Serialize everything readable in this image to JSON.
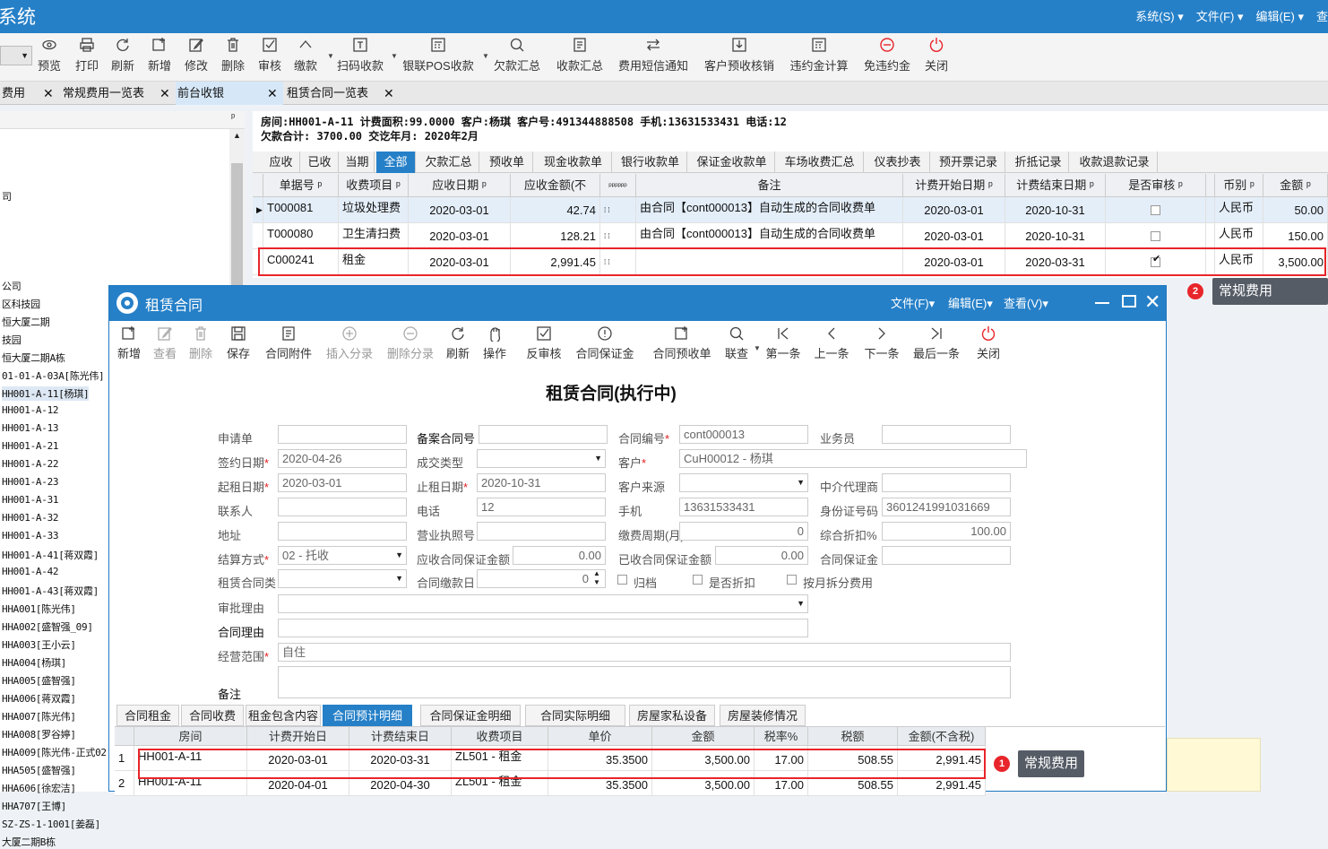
{
  "app": {
    "title": "系统",
    "menu": [
      "系统(S)",
      "文件(F)",
      "编辑(E)",
      "查"
    ]
  },
  "toolbar": [
    {
      "label": "预览",
      "icon": "eye-icon"
    },
    {
      "label": "打印",
      "icon": "printer-icon"
    },
    {
      "label": "刷新",
      "icon": "refresh-icon"
    },
    {
      "label": "新增",
      "icon": "add-icon"
    },
    {
      "label": "修改",
      "icon": "edit-icon"
    },
    {
      "label": "删除",
      "icon": "trash-icon"
    },
    {
      "label": "审核",
      "icon": "check-icon"
    },
    {
      "label": "缴款",
      "icon": "chevron-up-icon"
    },
    {
      "label": "扫码收款",
      "icon": "scan-icon"
    },
    {
      "label": "银联POS收款",
      "icon": "calculator-icon"
    },
    {
      "label": "欠款汇总",
      "icon": "search-icon"
    },
    {
      "label": "收款汇总",
      "icon": "document-icon"
    },
    {
      "label": "费用短信通知",
      "icon": "transfer-icon"
    },
    {
      "label": "客户预收核销",
      "icon": "download-icon"
    },
    {
      "label": "违约金计算",
      "icon": "calculator-icon"
    },
    {
      "label": "免违约金",
      "icon": "minus-circle-icon"
    },
    {
      "label": "关闭",
      "icon": "power-icon"
    }
  ],
  "tabs": [
    {
      "label": "费用"
    },
    {
      "label": "常规费用一览表"
    },
    {
      "label": "前台收银",
      "active": true
    },
    {
      "label": "租赁合同一览表"
    }
  ],
  "tree": {
    "items": [
      "司",
      "公司",
      "区科技园",
      "恒大厦二期",
      "技园",
      "恒大厦二期A栋",
      "01-01-A-03A[陈光伟]",
      "HH001-A-11[杨琪]",
      "HH001-A-12",
      "HH001-A-13",
      "HH001-A-21",
      "HH001-A-22",
      "HH001-A-23",
      "HH001-A-31",
      "HH001-A-32",
      "HH001-A-33",
      "HH001-A-41[蒋双霞]",
      "HH001-A-42",
      "HH001-A-43[蒋双霞]",
      "HHA001[陈光伟]",
      "HHA002[盛智强_09]",
      "HHA003[王小云]",
      "HHA004[杨琪]",
      "HHA005[盛智强]",
      "HHA006[蒋双霞]",
      "HHA007[陈光伟]",
      "HHA008[罗谷婷]",
      "HHA009[陈光伟-正式02",
      "HHA505[盛智强]",
      "HHA606[徐宏洁]",
      "HHA707[王博]",
      "SZ-ZS-1-1001[姜磊]",
      "大厦二期B栋"
    ],
    "selected_index": 7
  },
  "info": {
    "line1": "房间:HH001-A-11  计费面积:99.0000 客户:杨琪 客户号:491344888508 手机:13631533431 电话:12",
    "line2": "欠款合计: 3700.00  交讫年月: 2020年2月"
  },
  "subtabs": [
    "应收",
    "已收",
    "当期",
    "全部",
    "欠款汇总",
    "预收单",
    "现金收款单",
    "银行收款单",
    "保证金收款单",
    "车场收费汇总",
    "仪表抄表",
    "预开票记录",
    "折抵记录",
    "收款退款记录"
  ],
  "subtab_active": "全部",
  "grid": {
    "columns": [
      "单据号",
      "收费项目",
      "应收日期",
      "应收金额(不",
      "备注",
      "计费开始日期",
      "计费结束日期",
      "是否审核",
      "币别",
      "金额"
    ],
    "rows": [
      {
        "no": "T000081",
        "item": "垃圾处理费",
        "date": "2020-03-01",
        "amount": "42.74",
        "note": "由合同【cont000013】自动生成的合同收费单",
        "start": "2020-03-01",
        "end": "2020-10-31",
        "audited": false,
        "currency": "人民币",
        "total": "50.00"
      },
      {
        "no": "T000080",
        "item": "卫生清扫费",
        "date": "2020-03-01",
        "amount": "128.21",
        "note": "由合同【cont000013】自动生成的合同收费单",
        "start": "2020-03-01",
        "end": "2020-10-31",
        "audited": false,
        "currency": "人民币",
        "total": "150.00"
      },
      {
        "no": "C000241",
        "item": "租金",
        "date": "2020-03-01",
        "amount": "2,991.45",
        "note": "",
        "start": "2020-03-01",
        "end": "2020-03-31",
        "audited": true,
        "currency": "人民币",
        "total": "3,500.00"
      }
    ]
  },
  "callouts": [
    {
      "num": "2",
      "text": "常规费用"
    },
    {
      "num": "1",
      "text": "常规费用"
    }
  ],
  "dialog": {
    "title": "租赁合同",
    "menu": [
      "文件(F)",
      "编辑(E)",
      "查看(V)"
    ],
    "toolbar": [
      {
        "label": "新增",
        "icon": "add-icon",
        "enabled": true
      },
      {
        "label": "查看",
        "icon": "edit-icon",
        "enabled": false
      },
      {
        "label": "删除",
        "icon": "trash-icon",
        "enabled": false
      },
      {
        "label": "保存",
        "icon": "save-icon",
        "enabled": true
      },
      {
        "label": "合同附件",
        "icon": "document-icon",
        "enabled": true
      },
      {
        "label": "插入分录",
        "icon": "plus-circle-icon",
        "enabled": false
      },
      {
        "label": "删除分录",
        "icon": "minus-circle-icon",
        "enabled": false
      },
      {
        "label": "刷新",
        "icon": "refresh-icon",
        "enabled": true
      },
      {
        "label": "操作",
        "icon": "hand-icon",
        "enabled": true
      },
      {
        "label": "反审核",
        "icon": "check-icon",
        "enabled": true
      },
      {
        "label": "合同保证金",
        "icon": "info-circle-icon",
        "enabled": true
      },
      {
        "label": "合同预收单",
        "icon": "add-icon",
        "enabled": true
      },
      {
        "label": "联查",
        "icon": "search-icon",
        "enabled": true
      },
      {
        "label": "第一条",
        "icon": "first-icon",
        "enabled": true
      },
      {
        "label": "上一条",
        "icon": "prev-icon",
        "enabled": true
      },
      {
        "label": "下一条",
        "icon": "next-icon",
        "enabled": true
      },
      {
        "label": "最后一条",
        "icon": "last-icon",
        "enabled": true
      },
      {
        "label": "关闭",
        "icon": "power-icon",
        "enabled": true
      }
    ],
    "form_title": "租赁合同(执行中)",
    "labels": {
      "apply": "申请单",
      "record_no": "备案合同号",
      "contract_no": "合同编号",
      "salesman": "业务员",
      "sign_date": "签约日期",
      "deal_type": "成交类型",
      "customer": "客户",
      "start_date": "起租日期",
      "end_date": "止租日期",
      "cust_source": "客户来源",
      "agent": "中介代理商",
      "contact": "联系人",
      "phone": "电话",
      "mobile": "手机",
      "id_no": "身份证号码",
      "address": "地址",
      "license": "营业执照号",
      "pay_cycle": "缴费周期(月)",
      "discount": "综合折扣%",
      "settle": "结算方式",
      "recv_deposit": "应收合同保证金额",
      "got_deposit": "已收合同保证金额",
      "deposit": "合同保证金",
      "lease_type": "租赁合同类",
      "pay_day": "合同缴款日",
      "archive": "归档",
      "is_discount": "是否折扣",
      "split": "按月拆分费用",
      "approve_reason": "审批理由",
      "contract_reason": "合同理由",
      "scope": "经营范围",
      "remark": "备注"
    },
    "values": {
      "contract_no": "cont000013",
      "sign_date": "2020-04-26",
      "customer": "CuH00012 - 杨琪",
      "start_date": "2020-03-01",
      "end_date": "2020-10-31",
      "phone": "12",
      "mobile": "13631533431",
      "id_no": "3601241991031669",
      "pay_cycle": "0",
      "discount": "100.00",
      "settle": "02 - 托收",
      "recv_deposit": "0.00",
      "got_deposit": "0.00",
      "pay_day": "0",
      "scope": "自住"
    },
    "bottom_tabs": [
      "合同租金",
      "合同收费",
      "租金包含内容",
      "合同预计明细",
      "合同保证金明细",
      "合同实际明细",
      "房屋家私设备",
      "房屋装修情况"
    ],
    "bottom_tab_active": "合同预计明细",
    "detail_columns": [
      "房间",
      "计费开始日",
      "计费结束日",
      "收费项目",
      "单价",
      "金额",
      "税率%",
      "税额",
      "金额(不含税)"
    ],
    "detail_rows": [
      {
        "idx": "1",
        "room": "HH001-A-11",
        "start": "2020-03-01",
        "end": "2020-03-31",
        "item": "ZL501 - 租金",
        "price": "35.3500",
        "amount": "3,500.00",
        "rate": "17.00",
        "tax": "508.55",
        "net": "2,991.45"
      },
      {
        "idx": "2",
        "room": "HH001-A-11",
        "start": "2020-04-01",
        "end": "2020-04-30",
        "item": "ZL501 - 租金",
        "price": "35.3500",
        "amount": "3,500.00",
        "rate": "17.00",
        "tax": "508.55",
        "net": "2,991.45"
      }
    ]
  },
  "colors": {
    "accent": "#2680c8",
    "highlight": "#e8252a"
  }
}
